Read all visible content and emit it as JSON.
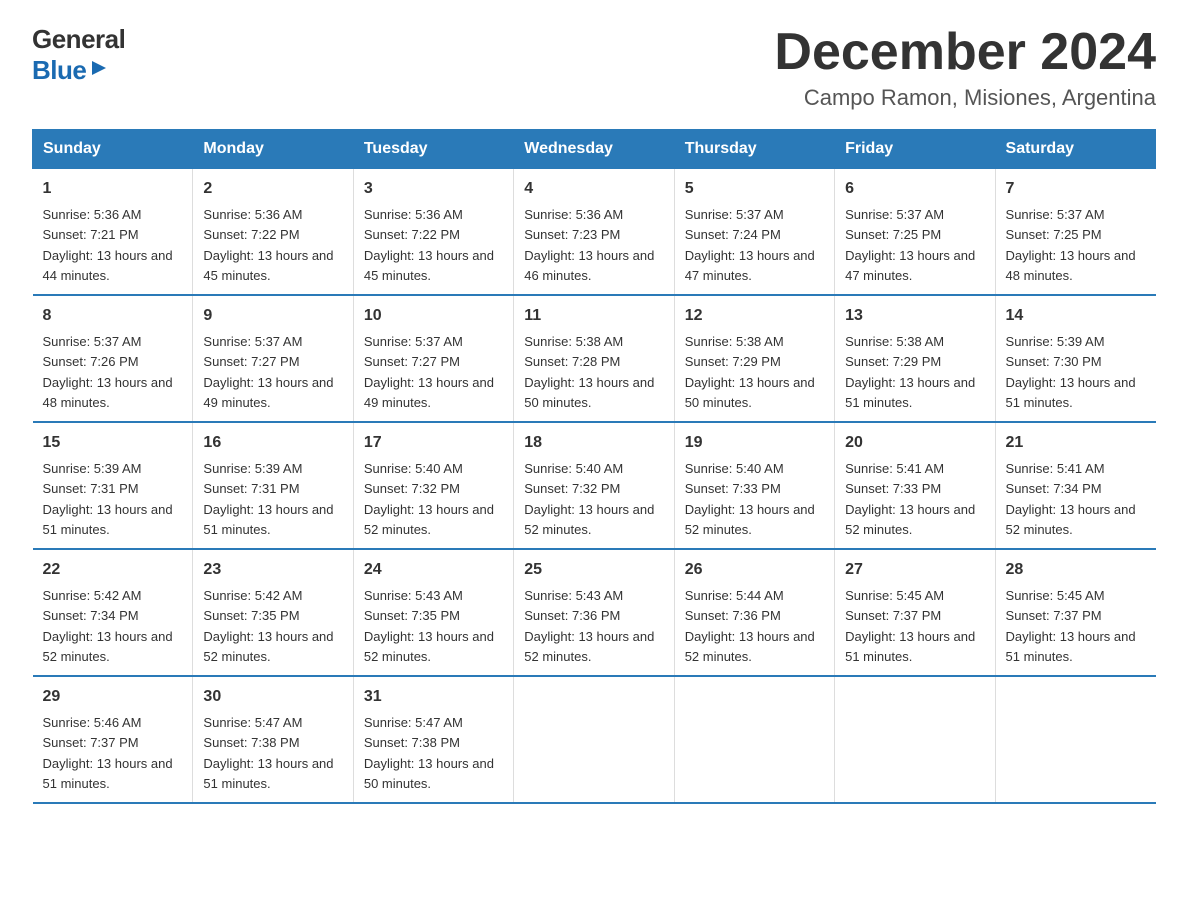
{
  "header": {
    "title": "December 2024",
    "subtitle": "Campo Ramon, Misiones, Argentina"
  },
  "logo": {
    "line1": "General",
    "line2": "Blue"
  },
  "days_header": [
    "Sunday",
    "Monday",
    "Tuesday",
    "Wednesday",
    "Thursday",
    "Friday",
    "Saturday"
  ],
  "weeks": [
    [
      {
        "day": "1",
        "sunrise": "5:36 AM",
        "sunset": "7:21 PM",
        "daylight": "13 hours and 44 minutes."
      },
      {
        "day": "2",
        "sunrise": "5:36 AM",
        "sunset": "7:22 PM",
        "daylight": "13 hours and 45 minutes."
      },
      {
        "day": "3",
        "sunrise": "5:36 AM",
        "sunset": "7:22 PM",
        "daylight": "13 hours and 45 minutes."
      },
      {
        "day": "4",
        "sunrise": "5:36 AM",
        "sunset": "7:23 PM",
        "daylight": "13 hours and 46 minutes."
      },
      {
        "day": "5",
        "sunrise": "5:37 AM",
        "sunset": "7:24 PM",
        "daylight": "13 hours and 47 minutes."
      },
      {
        "day": "6",
        "sunrise": "5:37 AM",
        "sunset": "7:25 PM",
        "daylight": "13 hours and 47 minutes."
      },
      {
        "day": "7",
        "sunrise": "5:37 AM",
        "sunset": "7:25 PM",
        "daylight": "13 hours and 48 minutes."
      }
    ],
    [
      {
        "day": "8",
        "sunrise": "5:37 AM",
        "sunset": "7:26 PM",
        "daylight": "13 hours and 48 minutes."
      },
      {
        "day": "9",
        "sunrise": "5:37 AM",
        "sunset": "7:27 PM",
        "daylight": "13 hours and 49 minutes."
      },
      {
        "day": "10",
        "sunrise": "5:37 AM",
        "sunset": "7:27 PM",
        "daylight": "13 hours and 49 minutes."
      },
      {
        "day": "11",
        "sunrise": "5:38 AM",
        "sunset": "7:28 PM",
        "daylight": "13 hours and 50 minutes."
      },
      {
        "day": "12",
        "sunrise": "5:38 AM",
        "sunset": "7:29 PM",
        "daylight": "13 hours and 50 minutes."
      },
      {
        "day": "13",
        "sunrise": "5:38 AM",
        "sunset": "7:29 PM",
        "daylight": "13 hours and 51 minutes."
      },
      {
        "day": "14",
        "sunrise": "5:39 AM",
        "sunset": "7:30 PM",
        "daylight": "13 hours and 51 minutes."
      }
    ],
    [
      {
        "day": "15",
        "sunrise": "5:39 AM",
        "sunset": "7:31 PM",
        "daylight": "13 hours and 51 minutes."
      },
      {
        "day": "16",
        "sunrise": "5:39 AM",
        "sunset": "7:31 PM",
        "daylight": "13 hours and 51 minutes."
      },
      {
        "day": "17",
        "sunrise": "5:40 AM",
        "sunset": "7:32 PM",
        "daylight": "13 hours and 52 minutes."
      },
      {
        "day": "18",
        "sunrise": "5:40 AM",
        "sunset": "7:32 PM",
        "daylight": "13 hours and 52 minutes."
      },
      {
        "day": "19",
        "sunrise": "5:40 AM",
        "sunset": "7:33 PM",
        "daylight": "13 hours and 52 minutes."
      },
      {
        "day": "20",
        "sunrise": "5:41 AM",
        "sunset": "7:33 PM",
        "daylight": "13 hours and 52 minutes."
      },
      {
        "day": "21",
        "sunrise": "5:41 AM",
        "sunset": "7:34 PM",
        "daylight": "13 hours and 52 minutes."
      }
    ],
    [
      {
        "day": "22",
        "sunrise": "5:42 AM",
        "sunset": "7:34 PM",
        "daylight": "13 hours and 52 minutes."
      },
      {
        "day": "23",
        "sunrise": "5:42 AM",
        "sunset": "7:35 PM",
        "daylight": "13 hours and 52 minutes."
      },
      {
        "day": "24",
        "sunrise": "5:43 AM",
        "sunset": "7:35 PM",
        "daylight": "13 hours and 52 minutes."
      },
      {
        "day": "25",
        "sunrise": "5:43 AM",
        "sunset": "7:36 PM",
        "daylight": "13 hours and 52 minutes."
      },
      {
        "day": "26",
        "sunrise": "5:44 AM",
        "sunset": "7:36 PM",
        "daylight": "13 hours and 52 minutes."
      },
      {
        "day": "27",
        "sunrise": "5:45 AM",
        "sunset": "7:37 PM",
        "daylight": "13 hours and 51 minutes."
      },
      {
        "day": "28",
        "sunrise": "5:45 AM",
        "sunset": "7:37 PM",
        "daylight": "13 hours and 51 minutes."
      }
    ],
    [
      {
        "day": "29",
        "sunrise": "5:46 AM",
        "sunset": "7:37 PM",
        "daylight": "13 hours and 51 minutes."
      },
      {
        "day": "30",
        "sunrise": "5:47 AM",
        "sunset": "7:38 PM",
        "daylight": "13 hours and 51 minutes."
      },
      {
        "day": "31",
        "sunrise": "5:47 AM",
        "sunset": "7:38 PM",
        "daylight": "13 hours and 50 minutes."
      },
      null,
      null,
      null,
      null
    ]
  ],
  "colors": {
    "header_bg": "#2a7ab8",
    "header_text": "#ffffff",
    "border": "#2a7ab8",
    "accent": "#1a6ab1"
  }
}
